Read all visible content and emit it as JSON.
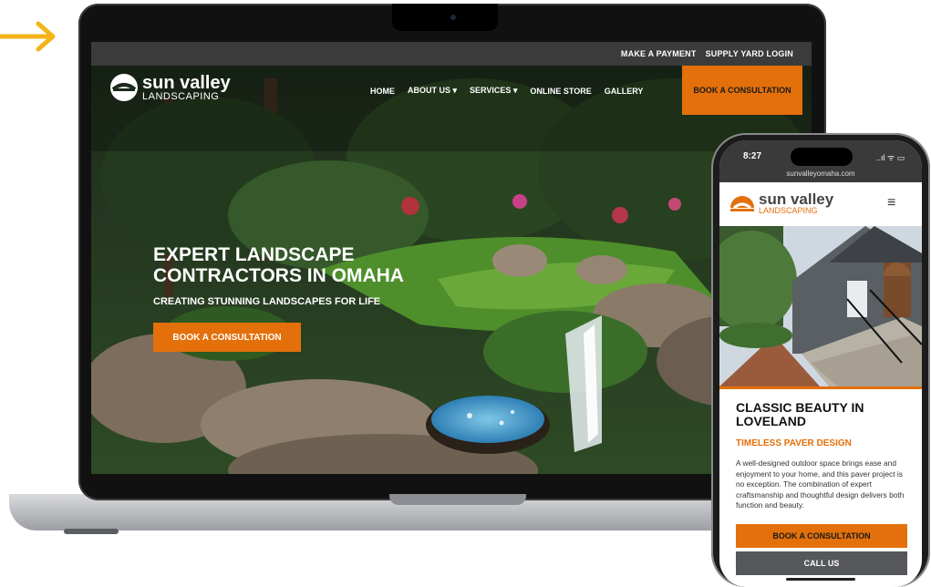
{
  "colors": {
    "accent": "#e3700b",
    "topbar": "#3b3b3b",
    "button_gray": "#55575a"
  },
  "decor": {
    "arrow_icon": "right-arrow-icon"
  },
  "laptop": {
    "topbar": {
      "make_payment": "MAKE A PAYMENT",
      "supply_login": "SUPPLY YARD LOGIN"
    },
    "logo": {
      "name": "sun valley",
      "sub": "LANDSCAPING"
    },
    "nav": [
      "HOME",
      "ABOUT US ▾",
      "SERVICES ▾",
      "ONLINE STORE",
      "GALLERY"
    ],
    "cta": "BOOK A CONSULTATION",
    "hero": {
      "title": "EXPERT LANDSCAPE CONTRACTORS IN OMAHA",
      "subtitle": "CREATING STUNNING LANDSCAPES FOR LIFE",
      "button": "BOOK A CONSULTATION"
    }
  },
  "phone": {
    "status": {
      "time": "8:27",
      "icons": "..ıl ᯤ ▭"
    },
    "url": "sunvalleyomaha.com",
    "logo": {
      "name": "sun valley",
      "sub": "LANDSCAPING"
    },
    "menu_icon": "≡",
    "title": "CLASSIC BEAUTY IN LOVELAND",
    "subtitle": "TIMELESS PAVER DESIGN",
    "body": "A well-designed outdoor space brings ease and enjoyment to your home, and this paver project is no exception. The combination of expert craftsmanship and thoughtful design delivers both function and beauty.",
    "button_primary": "BOOK A CONSULTATION",
    "button_secondary": "CALL US"
  }
}
